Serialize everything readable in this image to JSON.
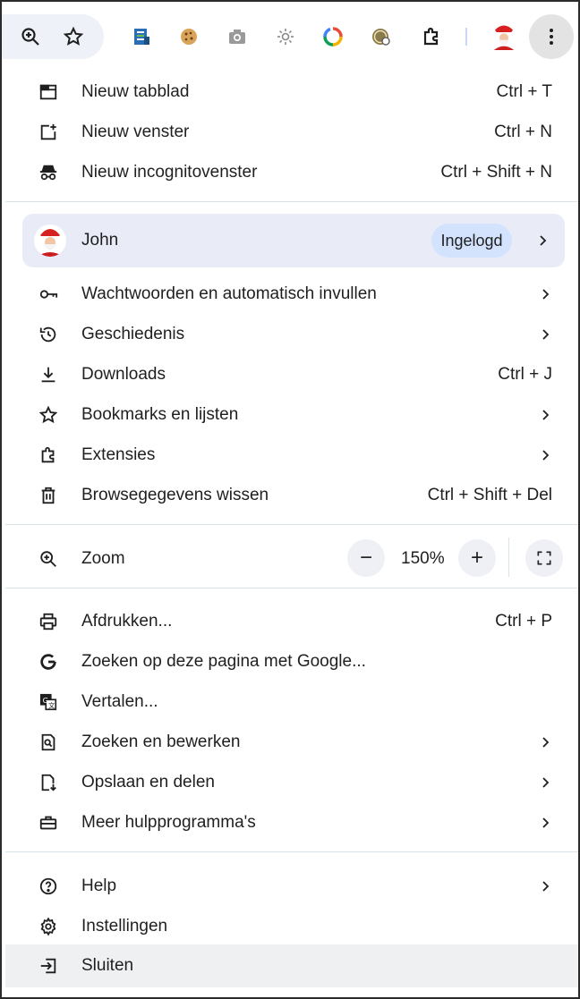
{
  "toolbar": {
    "icons": [
      "zoom-icon",
      "bookmark-star-icon",
      "ext-doc-icon",
      "ext-cookie-icon",
      "ext-camera-icon",
      "ext-sun-icon",
      "ext-color-ring-icon",
      "ext-seal-icon",
      "extensions-puzzle-icon",
      "avatar",
      "menu-kebab-icon"
    ]
  },
  "section1": [
    {
      "label": "Nieuw tabblad",
      "shortcut": "Ctrl + T"
    },
    {
      "label": "Nieuw venster",
      "shortcut": "Ctrl + N"
    },
    {
      "label": "Nieuw incognitovenster",
      "shortcut": "Ctrl + Shift + N"
    }
  ],
  "profile": {
    "name": "John",
    "status": "Ingelogd"
  },
  "section2": [
    {
      "label": "Wachtwoorden en automatisch invullen"
    },
    {
      "label": "Geschiedenis"
    },
    {
      "label": "Downloads",
      "shortcut": "Ctrl + J"
    },
    {
      "label": "Bookmarks en lijsten"
    },
    {
      "label": "Extensies"
    },
    {
      "label": "Browsegegevens wissen",
      "shortcut": "Ctrl + Shift + Del"
    }
  ],
  "zoom": {
    "label": "Zoom",
    "minus": "−",
    "value": "150%",
    "plus": "+"
  },
  "section3": [
    {
      "label": "Afdrukken...",
      "shortcut": "Ctrl + P"
    },
    {
      "label": "Zoeken op deze pagina met Google..."
    },
    {
      "label": "Vertalen..."
    },
    {
      "label": "Zoeken en bewerken"
    },
    {
      "label": "Opslaan en delen"
    },
    {
      "label": "Meer hulpprogramma's"
    }
  ],
  "section4": [
    {
      "label": "Help"
    },
    {
      "label": "Instellingen"
    },
    {
      "label": "Sluiten"
    }
  ],
  "colors": {
    "accent_badge": "#d3e3fd",
    "profile_bg": "#e9ecf7",
    "menu_button": "#e3e3e3"
  }
}
